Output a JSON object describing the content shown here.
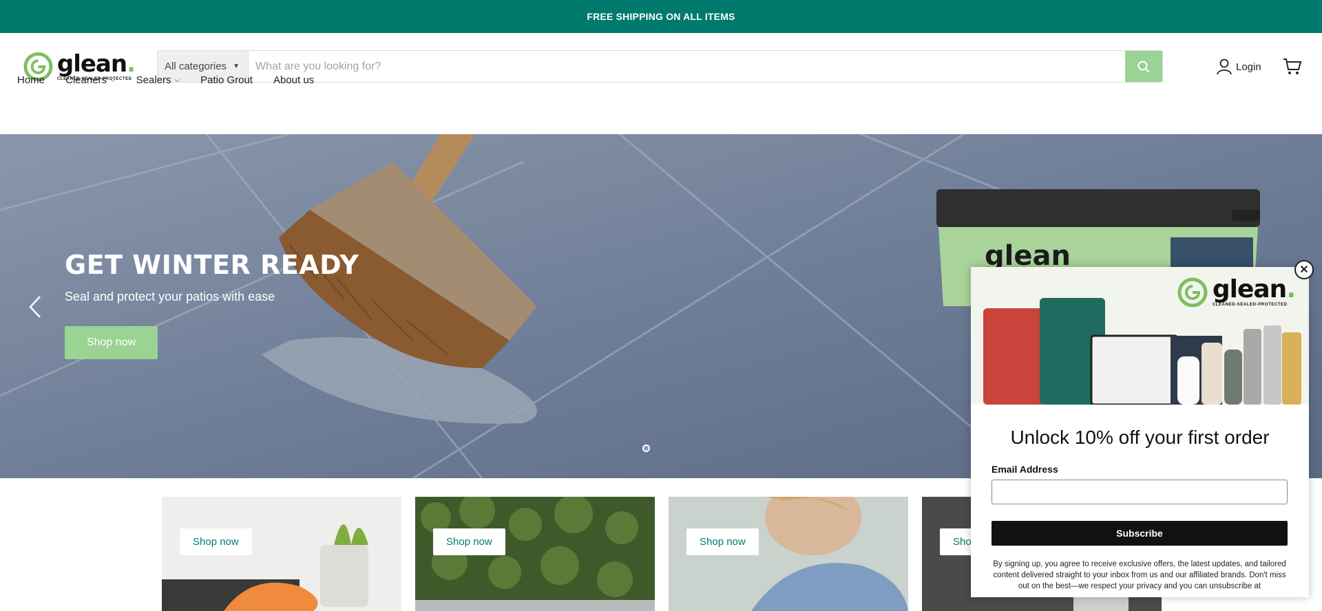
{
  "announcement": {
    "text": "FREE SHIPPING ON ALL ITEMS"
  },
  "logo": {
    "word": "glean",
    "tagline": "CLEANED·SEALED·PROTECTED"
  },
  "search": {
    "category": "All categories",
    "placeholder": "What are you looking for?"
  },
  "account": {
    "login_label": "Login"
  },
  "nav": {
    "items": [
      "Home",
      "Cleaners",
      "Sealers",
      "Patio Grout",
      "About us"
    ]
  },
  "hero": {
    "title": "GET WINTER READY",
    "subtitle": "Seal and protect your patios with ease",
    "button": "Shop now"
  },
  "cards": [
    {
      "button": "Shop now"
    },
    {
      "button": "Shop now"
    },
    {
      "button": "Shop now"
    },
    {
      "button": "Shop now"
    }
  ],
  "popup": {
    "logo_word": "glean",
    "logo_tagline": "CLEANED-SEALED-PROTECTED",
    "title": "Unlock 10% off your first order",
    "email_label": "Email Address",
    "subscribe": "Subscribe",
    "fine_print": "By signing up, you agree to receive exclusive offers, the latest updates, and tailored content delivered straight to your inbox from us and our affiliated brands. Don't miss out on the best—we respect your privacy and you can unsubscribe at",
    "close": "✕"
  },
  "colors": {
    "brand_teal": "#007a6c",
    "brand_green": "#9ad393"
  }
}
